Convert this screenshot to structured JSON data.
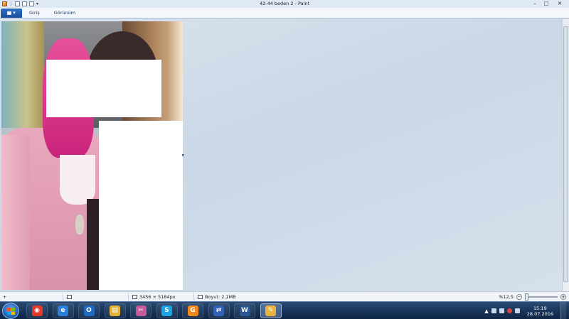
{
  "window": {
    "title": "42-44 beden 2 - Paint",
    "minimize_glyph": "–",
    "maximize_glyph": "□",
    "close_glyph": "✕"
  },
  "quick_access": {
    "icons": [
      "paint-app-icon",
      "save-icon",
      "undo-icon",
      "redo-icon"
    ],
    "caret": "▾"
  },
  "ribbon": {
    "file_caret": "▾",
    "tabs": [
      {
        "label": "Giriş"
      },
      {
        "label": "Görünüm"
      }
    ]
  },
  "statusbar": {
    "add_glyph": "+",
    "dimensions": "3456 × 5184px",
    "size": "Boyut: 2,1MB",
    "zoom": "%12,5",
    "zoom_out": "−",
    "zoom_in": "+"
  },
  "taskbar": {
    "apps": [
      {
        "name": "chrome",
        "glyph": "◉",
        "color": "#e6382a"
      },
      {
        "name": "internet-explorer",
        "glyph": "e",
        "color": "#2a7fd6"
      },
      {
        "name": "outlook",
        "glyph": "O",
        "color": "#1f6bc2"
      },
      {
        "name": "explorer",
        "glyph": "▤",
        "color": "#e4b43a"
      },
      {
        "name": "snipping-tool",
        "glyph": "✂",
        "color": "#c75a9a"
      },
      {
        "name": "skype",
        "glyph": "S",
        "color": "#1aa3e6"
      },
      {
        "name": "gom-player",
        "glyph": "G",
        "color": "#f08a1c"
      },
      {
        "name": "network-manager",
        "glyph": "⇄",
        "color": "#3361b8"
      },
      {
        "name": "word",
        "glyph": "W",
        "color": "#2b5797"
      },
      {
        "name": "paint",
        "glyph": "✎",
        "color": "#e9b340"
      }
    ],
    "clock_time": "15:19",
    "clock_date": "28.07.2016",
    "tray_caret": "▲"
  },
  "colors": {
    "workspace": "#cad7e6",
    "taskbar": "#183459",
    "file_tab": "#1a4f99"
  }
}
